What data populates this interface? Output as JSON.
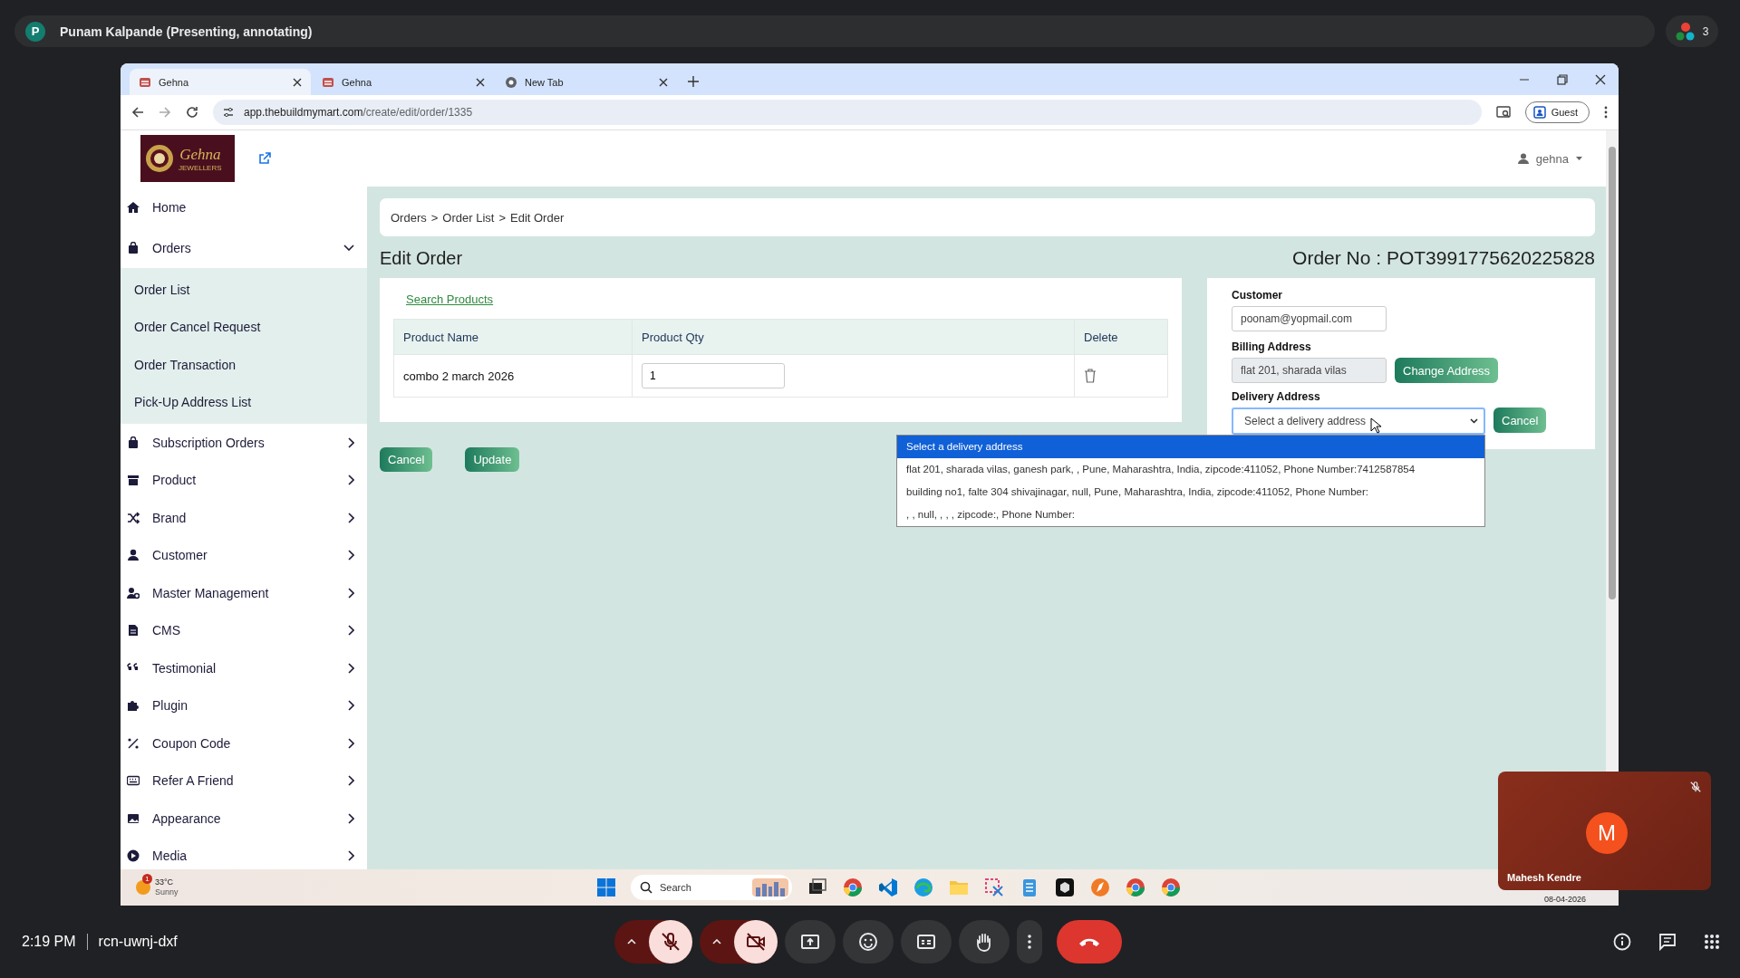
{
  "meet": {
    "presenter": {
      "initial": "P",
      "label": "Punam Kalpande (Presenting, annotating)"
    },
    "participant_count": "3",
    "time": "2:19 PM",
    "meeting_code": "rcn-uwnj-dxf",
    "controls": [
      {
        "kind": "mic",
        "on": false
      },
      {
        "kind": "camera",
        "on": false
      },
      {
        "kind": "present"
      },
      {
        "kind": "reactions"
      },
      {
        "kind": "captions"
      },
      {
        "kind": "hand"
      },
      {
        "kind": "more"
      },
      {
        "kind": "leave"
      }
    ],
    "tile": {
      "initial": "M",
      "name": "Mahesh Kendre",
      "muted": true
    }
  },
  "browser": {
    "tabs": [
      {
        "title": "Gehna",
        "kind": "site",
        "selected": true
      },
      {
        "title": "Gehna",
        "kind": "site",
        "selected": false
      },
      {
        "title": "New Tab",
        "kind": "newtab",
        "selected": false
      }
    ],
    "url_host": "app.thebuildmymart.com",
    "url_path": "/create/edit/order/1335",
    "profile": "Guest"
  },
  "page": {
    "logo": {
      "name": "Gehna",
      "tagline": "JEWELLERS"
    },
    "user": "gehna",
    "sidebar": {
      "items": [
        {
          "label": "Home",
          "kind": "link"
        },
        {
          "label": "Orders",
          "kind": "group",
          "expanded": true,
          "children": [
            {
              "label": "Order List"
            },
            {
              "label": "Order Cancel Request"
            },
            {
              "label": "Order Transaction"
            },
            {
              "label": "Pick-Up Address List"
            }
          ]
        },
        {
          "label": "Subscription Orders",
          "kind": "group",
          "expanded": false
        },
        {
          "label": "Product",
          "kind": "group",
          "expanded": false
        },
        {
          "label": "Brand",
          "kind": "group",
          "expanded": false
        },
        {
          "label": "Customer",
          "kind": "group",
          "expanded": false
        },
        {
          "label": "Master Management",
          "kind": "group",
          "expanded": false
        },
        {
          "label": "CMS",
          "kind": "group",
          "expanded": false
        },
        {
          "label": "Testimonial",
          "kind": "group",
          "expanded": false
        },
        {
          "label": "Plugin",
          "kind": "group",
          "expanded": false
        },
        {
          "label": "Coupon Code",
          "kind": "group",
          "expanded": false
        },
        {
          "label": "Refer A Friend",
          "kind": "group",
          "expanded": false
        },
        {
          "label": "Appearance",
          "kind": "group",
          "expanded": false
        },
        {
          "label": "Media",
          "kind": "group",
          "expanded": false
        }
      ]
    },
    "breadcrumb": {
      "items": [
        "Orders",
        "Order List",
        "Edit Order"
      ],
      "separator": ">"
    },
    "title": "Edit Order",
    "order_no": "Order No : POT3991775620225828",
    "products": {
      "search_link": "Search Products",
      "columns": [
        "Product Name",
        "Product Qty",
        "Delete"
      ],
      "rows": [
        {
          "name": "combo 2 march 2026",
          "qty": "1"
        }
      ]
    },
    "actions": [
      {
        "label": "Cancel"
      },
      {
        "label": "Update"
      }
    ],
    "order_form": {
      "customer": {
        "label": "Customer",
        "value": "poonam@yopmail.com",
        "disabled": false
      },
      "billing": {
        "label": "Billing Address",
        "value": "flat 201, sharada vilas",
        "disabled": true,
        "button": "Change Address"
      },
      "delivery": {
        "label": "Delivery Address",
        "value": "Select a delivery address",
        "open": true,
        "button": "Cancel",
        "options": [
          {
            "label": "Select a delivery address",
            "selected": true
          },
          {
            "label": "flat 201, sharada vilas, ganesh park, , Pune, Maharashtra, India, zipcode:411052, Phone Number:7412587854",
            "selected": false
          },
          {
            "label": "building no1, falte 304 shivajinagar, null, Pune, Maharashtra, India, zipcode:411052, Phone Number:",
            "selected": false
          },
          {
            "label": ", , null, , , , zipcode:, Phone Number:",
            "selected": false
          }
        ]
      }
    }
  },
  "taskbar": {
    "weather": {
      "badge": "1",
      "temperature": "33°C",
      "condition": "Sunny"
    },
    "search_placeholder": "Search",
    "date": "08-04-2026"
  }
}
